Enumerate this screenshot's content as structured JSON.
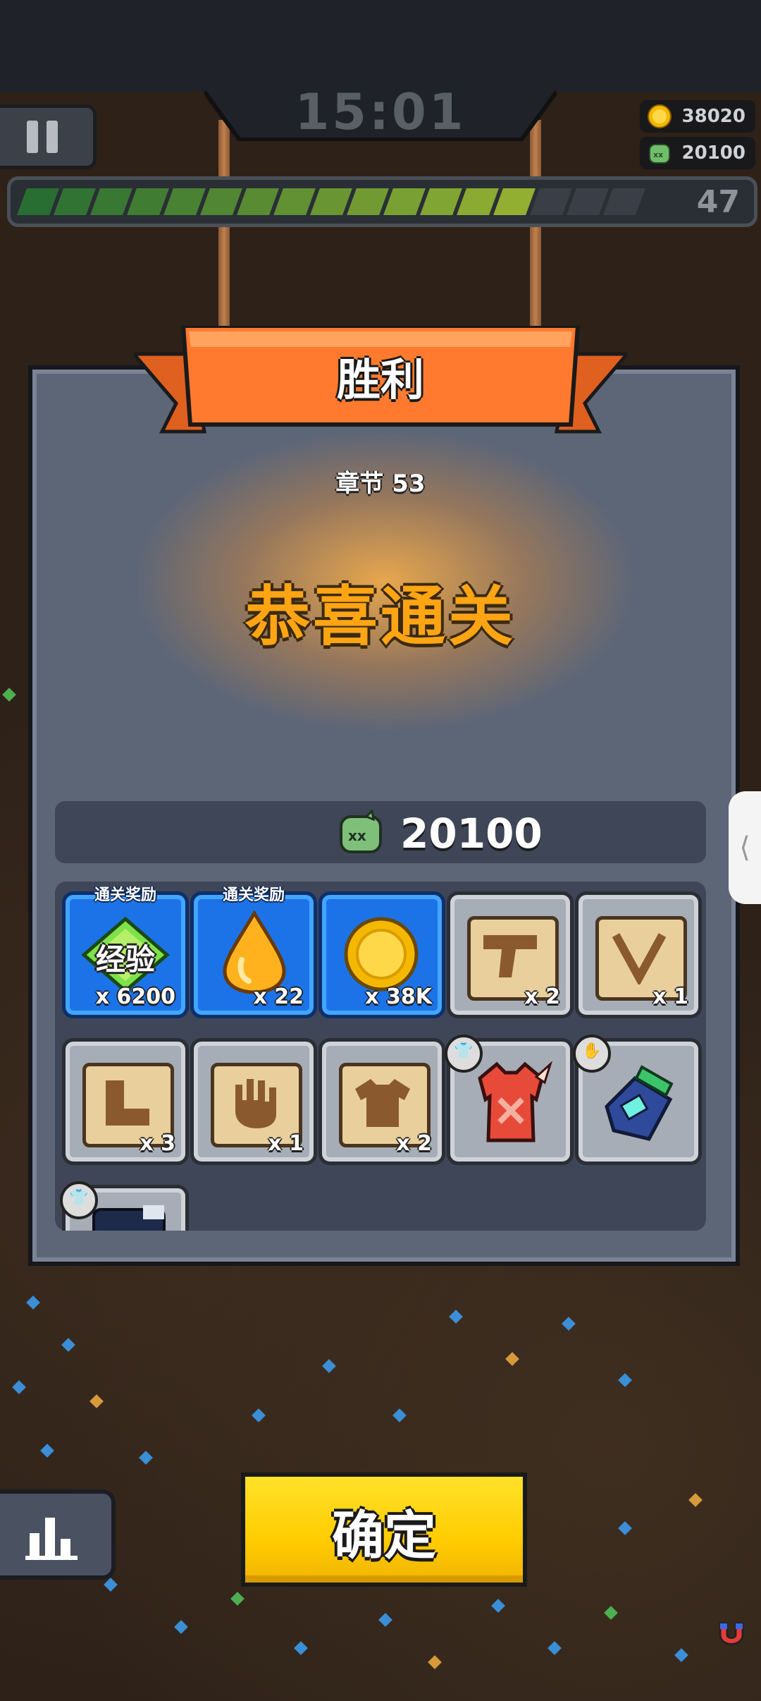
{
  "hud": {
    "timer": "15:01",
    "coins": "38020",
    "kills": "20100",
    "level": "47",
    "xp_progress": 0.84
  },
  "dialog": {
    "title": "胜利",
    "chapter": "章节 53",
    "headline": "恭喜通关",
    "kill_total": "20100"
  },
  "rewards": [
    {
      "label": "通关奖励",
      "name": "经验",
      "qty": "x 6200",
      "style": "blue",
      "icon": "exp-gem-icon"
    },
    {
      "label": "通关奖励",
      "qty": "x 22",
      "style": "blue",
      "icon": "orange-droplet-icon"
    },
    {
      "qty": "x 38K",
      "style": "blue",
      "icon": "gold-coin-icon"
    },
    {
      "qty": "x 2",
      "style": "grey",
      "icon": "pistol-scroll-icon"
    },
    {
      "qty": "x 1",
      "style": "grey",
      "icon": "necklace-scroll-icon"
    },
    {
      "qty": "x 3",
      "style": "grey",
      "icon": "boots-scroll-icon"
    },
    {
      "qty": "x 1",
      "style": "grey",
      "icon": "glove-scroll-icon"
    },
    {
      "qty": "x 2",
      "style": "grey",
      "icon": "armor-scroll-icon"
    },
    {
      "style": "grey",
      "icon": "red-armor-icon",
      "badge": "armor-badge-icon"
    },
    {
      "style": "grey",
      "icon": "blue-gauntlet-icon",
      "badge": "glove-badge-icon"
    },
    {
      "style": "grey",
      "icon": "partial-item-icon",
      "badge": "armor-badge-icon"
    }
  ],
  "buttons": {
    "confirm": "确定"
  },
  "colors": {
    "accent_orange": "#ff7a2e",
    "headline": "#ffa514",
    "confirm_yellow": "#ffd200",
    "reward_blue": "#1c73e8"
  }
}
